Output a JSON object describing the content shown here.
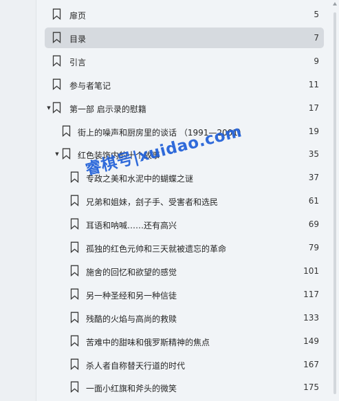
{
  "toc": {
    "items": [
      {
        "title": "扉页",
        "page": "5",
        "selected": false,
        "level": 0
      },
      {
        "title": "目录",
        "page": "7",
        "selected": true,
        "level": 0
      },
      {
        "title": "引言",
        "page": "9",
        "selected": false,
        "level": 0
      },
      {
        "title": "参与者笔记",
        "page": "11",
        "selected": false,
        "level": 0
      },
      {
        "title": "第一部 启示录的慰籍",
        "page": "17",
        "selected": false,
        "level": 0,
        "expanded": true
      },
      {
        "title": "街上的噪声和厨房里的谈话 （1991—2001）",
        "page": "19",
        "selected": false,
        "level": 1
      },
      {
        "title": "红色装饰内的十个故事",
        "page": "35",
        "selected": false,
        "level": 1,
        "expanded": true
      },
      {
        "title": "专政之美和水泥中的蝴蝶之谜",
        "page": "37",
        "selected": false,
        "level": 2
      },
      {
        "title": "兄弟和姐妹，刽子手、受害者和选民",
        "page": "61",
        "selected": false,
        "level": 2
      },
      {
        "title": "耳语和呐喊……还有高兴",
        "page": "69",
        "selected": false,
        "level": 2
      },
      {
        "title": "孤独的红色元帅和三天就被遗忘的革命",
        "page": "79",
        "selected": false,
        "level": 2
      },
      {
        "title": "施舍的回忆和欲望的感觉",
        "page": "101",
        "selected": false,
        "level": 2
      },
      {
        "title": "另一种圣经和另一种信徒",
        "page": "117",
        "selected": false,
        "level": 2
      },
      {
        "title": "残酷的火焰与高尚的救赎",
        "page": "133",
        "selected": false,
        "level": 2
      },
      {
        "title": "苦难中的甜味和俄罗斯精神的焦点",
        "page": "149",
        "selected": false,
        "level": 2
      },
      {
        "title": "杀人者自称替天行道的时代",
        "page": "167",
        "selected": false,
        "level": 2
      },
      {
        "title": "一面小红旗和斧头的微笑",
        "page": "175",
        "selected": false,
        "level": 2
      }
    ]
  },
  "icons": {
    "bookmark": "bookmark-outline-icon",
    "expand": "caret-down-icon"
  },
  "watermark": {
    "text": "睿棋号|xuidao.com"
  }
}
